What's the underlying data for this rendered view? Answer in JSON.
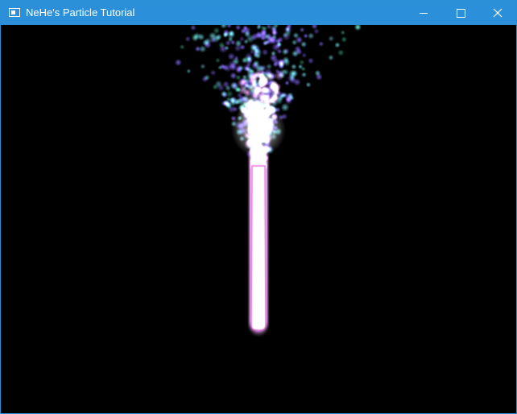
{
  "window": {
    "title": "NeHe's Particle Tutorial",
    "accent_color": "#2b90d9",
    "icons": {
      "app": "app-window-icon",
      "minimize": "minimize-icon",
      "maximize": "maximize-icon",
      "close": "close-icon"
    }
  },
  "scene": {
    "background_color": "#000000",
    "particle_colors": [
      "#ffffff",
      "#f0a8ff",
      "#8a6cff",
      "#6fd0e0",
      "#3aa87a"
    ]
  }
}
